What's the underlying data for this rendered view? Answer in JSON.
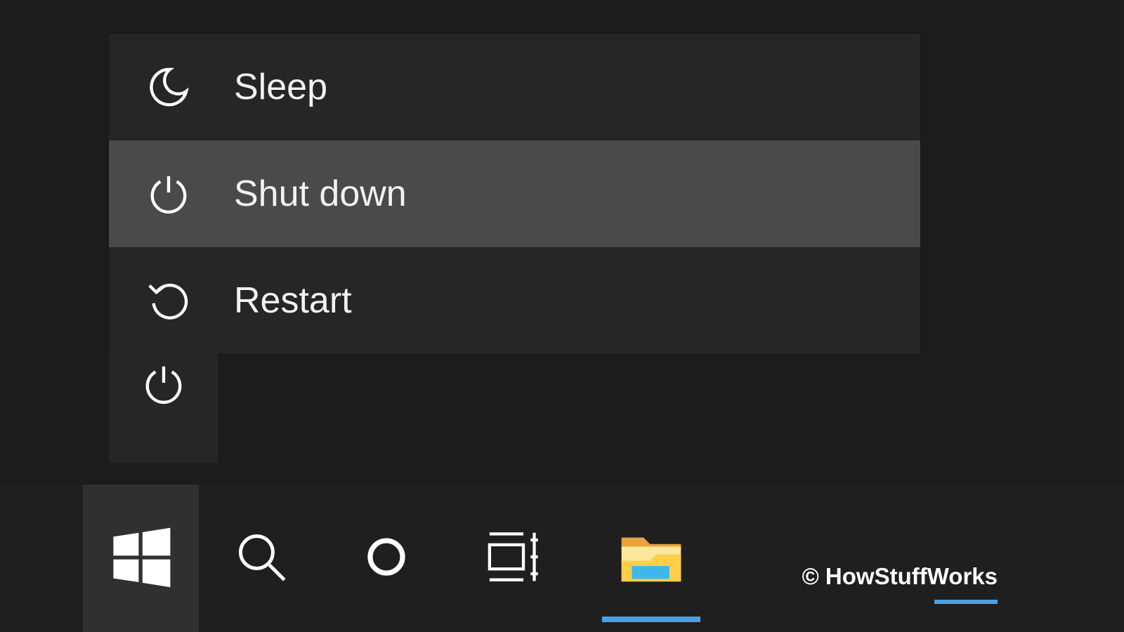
{
  "power_menu": {
    "items": [
      {
        "icon": "moon-icon",
        "label": "Sleep",
        "highlighted": false
      },
      {
        "icon": "power-icon",
        "label": "Shut down",
        "highlighted": true
      },
      {
        "icon": "restart-icon",
        "label": "Restart",
        "highlighted": false
      }
    ]
  },
  "start_rail": {
    "power_button_icon": "power-icon"
  },
  "taskbar": {
    "items": [
      {
        "name": "start",
        "icon": "windows-logo-icon",
        "active": true
      },
      {
        "name": "search",
        "icon": "search-icon",
        "active": false
      },
      {
        "name": "cortana",
        "icon": "cortana-ring-icon",
        "active": false
      },
      {
        "name": "task-view",
        "icon": "task-view-icon",
        "active": false
      },
      {
        "name": "file-explorer",
        "icon": "folder-icon",
        "active": false,
        "running": true
      }
    ]
  },
  "attribution": "© HowStuffWorks"
}
